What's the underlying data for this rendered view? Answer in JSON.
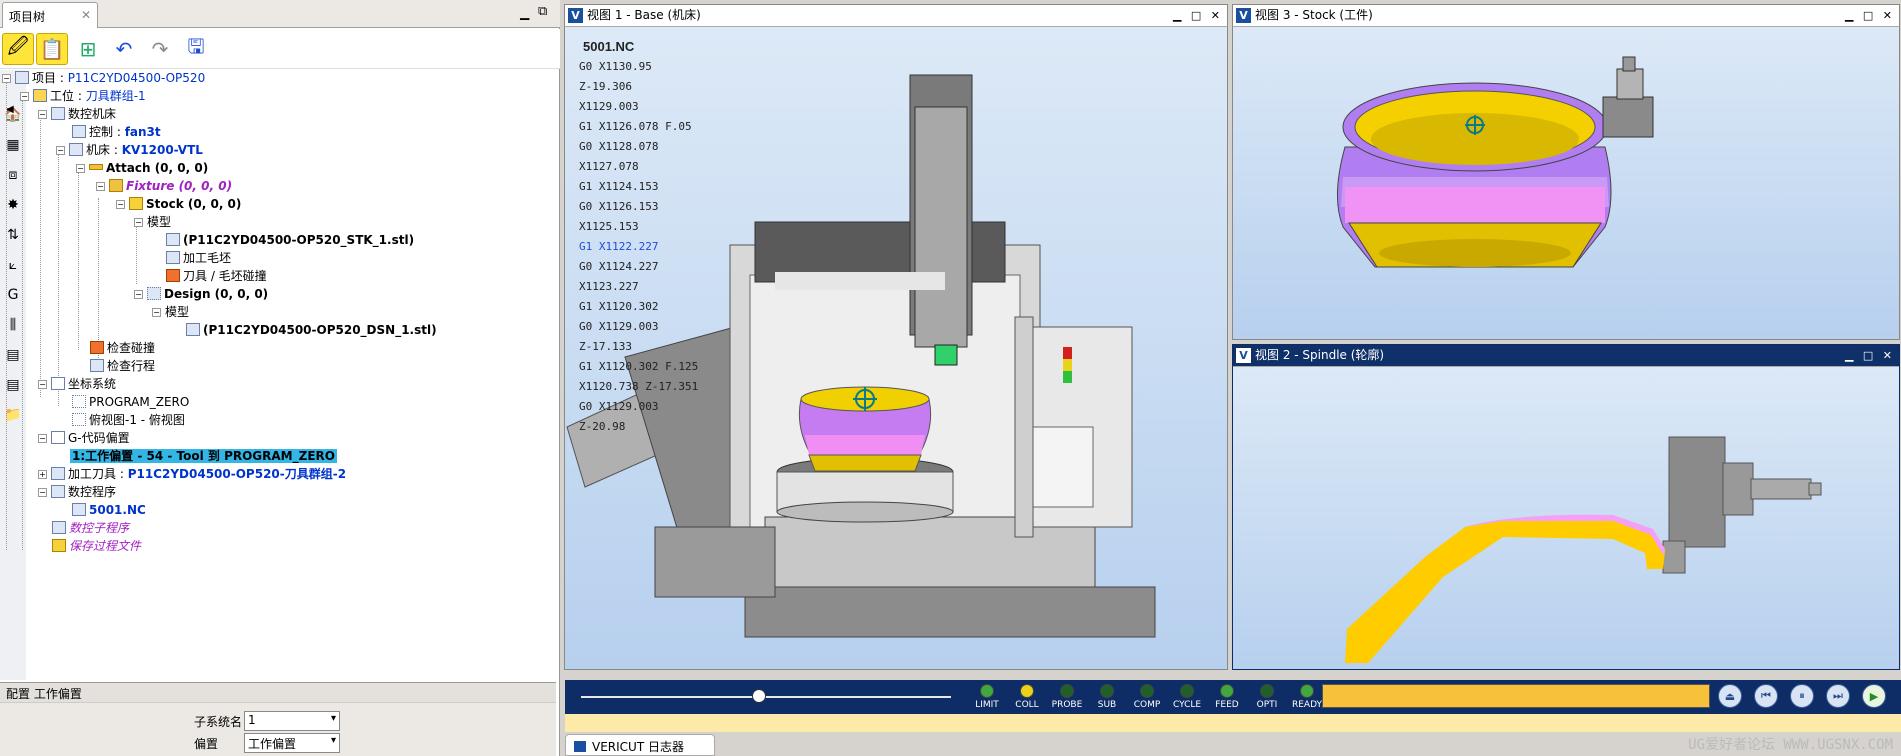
{
  "left_panel": {
    "tab_label": "项目树",
    "tree": {
      "project": {
        "prefix": "项目 :",
        "value": "P11C2YD04500-OP520"
      },
      "setup": {
        "prefix": "工位 :",
        "value": "刀具群组-1"
      },
      "cnc_machine": "数控机床",
      "control": {
        "prefix": "控制 :",
        "value": "fan3t"
      },
      "machine": {
        "prefix": "机床 :",
        "value": "KV1200-VTL"
      },
      "attach": "Attach (0, 0, 0)",
      "fixture": "Fixture (0, 0, 0)",
      "stock": "Stock (0, 0, 0)",
      "model_1": "模型",
      "stock_file": "(P11C2YD04500-OP520_STK_1.stl)",
      "cut_stock": "加工毛坯",
      "tool_stock_collision": "刀具 / 毛坯碰撞",
      "design": "Design (0, 0, 0)",
      "model_2": "模型",
      "design_file": "(P11C2YD04500-OP520_DSN_1.stl)",
      "check_collision": "检查碰撞",
      "check_travel": "检查行程",
      "coord_systems": "坐标系统",
      "program_zero": "PROGRAM_ZERO",
      "top_view": "俯视图-1 - 俯视图",
      "gcode_offsets": "G-代码偏置",
      "work_offset_item": "1:工作偏置 - 54 - Tool 到 PROGRAM_ZERO",
      "tools": {
        "prefix": "加工刀具 :",
        "value": "P11C2YD04500-OP520-刀具群组-2"
      },
      "nc_programs": "数控程序",
      "nc_file": "5001.NC",
      "nc_subroutines": "数控子程序",
      "save_process": "保存过程文件"
    },
    "config": {
      "title": "配置 工作偏置",
      "subsystem_label": "子系统名",
      "subsystem_value": "1",
      "offset_label": "偏置",
      "offset_value": "工作偏置"
    }
  },
  "view1": {
    "title": "视图 1 - Base (机床)",
    "nc_title": "5001.NC",
    "nc_lines": [
      "G0 X1130.95",
      "Z-19.306",
      "X1129.003",
      "G1 X1126.078 F.05",
      "G0 X1128.078",
      "X1127.078",
      "G1 X1124.153",
      "G0 X1126.153",
      "X1125.153",
      "G1 X1122.227",
      "G0 X1124.227",
      "X1123.227",
      "G1 X1120.302",
      "G0 X1129.003",
      "Z-17.133",
      "G1 X1120.302 F.125",
      "X1120.738 Z-17.351",
      "G0 X1129.003",
      "Z-20.98"
    ],
    "highlight_index": 9
  },
  "view3": {
    "title": "视图 3 - Stock (工件)"
  },
  "view2": {
    "title": "视图 2 - Spindle (轮廓)"
  },
  "status": {
    "leds": [
      {
        "label": "LIMIT",
        "color": "#3fa83f"
      },
      {
        "label": "COLL",
        "color": "#e8d21a"
      },
      {
        "label": "PROBE",
        "color": "#1f5f2a"
      },
      {
        "label": "SUB",
        "color": "#1f5f2a"
      },
      {
        "label": "COMP",
        "color": "#1f5f2a"
      },
      {
        "label": "CYCLE",
        "color": "#1f5f2a"
      },
      {
        "label": "FEED",
        "color": "#3fa83f"
      },
      {
        "label": "OPTI",
        "color": "#1f5f2a"
      },
      {
        "label": "READY",
        "color": "#3fa83f"
      }
    ],
    "slider_position": 0.48
  },
  "log_tab": "VERICUT 日志器",
  "watermark": "UG爱好者论坛 WWW.UGSNX.COM"
}
